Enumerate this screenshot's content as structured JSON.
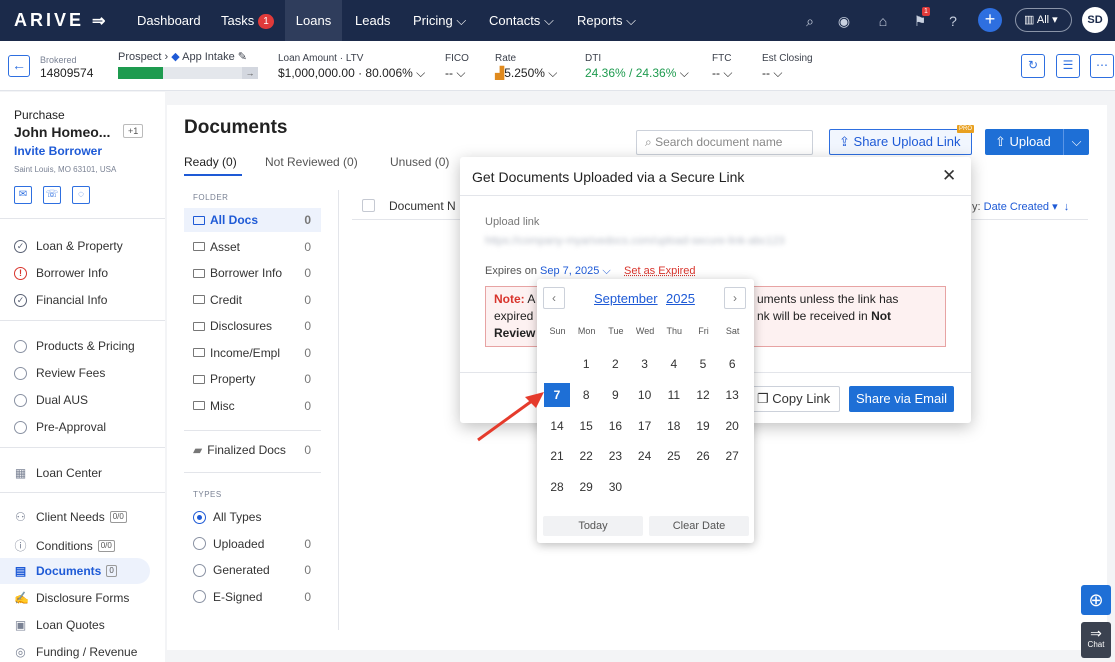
{
  "nav": {
    "logo": "ARIVE",
    "items": [
      "Dashboard",
      "Tasks",
      "Loans",
      "Leads",
      "Pricing",
      "Contacts",
      "Reports"
    ],
    "tasks_badge": "1",
    "notif_badge": "1",
    "all_label": "All",
    "avatar": "SD"
  },
  "loan": {
    "brokered": "Brokered",
    "number": "14809574",
    "stage": "Prospect",
    "stage2": "App Intake",
    "progress": 0.32,
    "amount_label": "Loan Amount · LTV",
    "amount": "$1,000,000.00",
    "ltv": "· 80.006%",
    "fico_label": "FICO",
    "fico": "--",
    "rate_label": "Rate",
    "rate": "5.250%",
    "dti_label": "DTI",
    "dti": "24.36% / 24.36%",
    "ftc_label": "FTC",
    "ftc": "--",
    "closing_label": "Est Closing",
    "closing": "--"
  },
  "borrower": {
    "type": "Purchase",
    "name": "John Homeo...",
    "plus": "+1",
    "invite": "Invite Borrower",
    "address": "Saint Louis, MO 63101, USA"
  },
  "sidebar": {
    "steps": [
      "Loan & Property",
      "Borrower Info",
      "Financial Info"
    ],
    "steps2": [
      "Products & Pricing",
      "Review Fees",
      "Dual AUS",
      "Pre-Approval"
    ],
    "loan_center": "Loan Center",
    "client_needs": "Client Needs",
    "client_needs_badge": "0/0",
    "conditions": "Conditions",
    "conditions_badge": "0/0",
    "documents": "Documents",
    "documents_badge": "0",
    "disclosure_forms": "Disclosure Forms",
    "loan_quotes": "Loan Quotes",
    "funding": "Funding / Revenue"
  },
  "docs": {
    "title": "Documents",
    "tabs": [
      "Ready (0)",
      "Not Reviewed (0)",
      "Unused (0)"
    ],
    "search_placeholder": "Search document name",
    "share_link": "Share Upload Link",
    "pro": "PRO",
    "upload": "Upload",
    "folder_label": "FOLDER",
    "folders": [
      {
        "name": "All Docs",
        "count": "0"
      },
      {
        "name": "Asset",
        "count": "0"
      },
      {
        "name": "Borrower Info",
        "count": "0"
      },
      {
        "name": "Credit",
        "count": "0"
      },
      {
        "name": "Disclosures",
        "count": "0"
      },
      {
        "name": "Income/Empl",
        "count": "0"
      },
      {
        "name": "Property",
        "count": "0"
      },
      {
        "name": "Misc",
        "count": "0"
      }
    ],
    "finalized": "Finalized Docs",
    "finalized_count": "0",
    "types_label": "TYPES",
    "types": [
      {
        "name": "All Types",
        "count": ""
      },
      {
        "name": "Uploaded",
        "count": "0"
      },
      {
        "name": "Generated",
        "count": "0"
      },
      {
        "name": "E-Signed",
        "count": "0"
      }
    ],
    "col_doc": "Document N",
    "sort_label": "y:",
    "sort_value": "Date Created"
  },
  "modal": {
    "title": "Get Documents Uploaded via a Secure Link",
    "upload_label": "Upload link",
    "upload_link_blurred": "https://company-myarivedocs.com/upload-secure-link-abc123",
    "expires_label": "Expires on",
    "expires_value": "Sep 7, 2025",
    "set_expired": "Set as Expired",
    "note_bold": "Note:",
    "note_a": "A",
    "note_right": "uments unless the link has",
    "note_l2a": "expired",
    "note_l2b": "nk will be received in",
    "note_l2c": "Not",
    "note_l3": "Review",
    "copy_link": "Copy Link",
    "share_email": "Share via Email"
  },
  "calendar": {
    "month": "September",
    "year": "2025",
    "dows": [
      "Sun",
      "Mon",
      "Tue",
      "Wed",
      "Thu",
      "Fri",
      "Sat"
    ],
    "weeks": [
      [
        "",
        "1",
        "2",
        "3",
        "4",
        "5",
        "6"
      ],
      [
        "7",
        "8",
        "9",
        "10",
        "11",
        "12",
        "13"
      ],
      [
        "14",
        "15",
        "16",
        "17",
        "18",
        "19",
        "20"
      ],
      [
        "21",
        "22",
        "23",
        "24",
        "25",
        "26",
        "27"
      ],
      [
        "28",
        "29",
        "30",
        "",
        "",
        "",
        ""
      ]
    ],
    "selected": "7",
    "today": "Today",
    "clear": "Clear Date"
  },
  "chat": "Chat"
}
